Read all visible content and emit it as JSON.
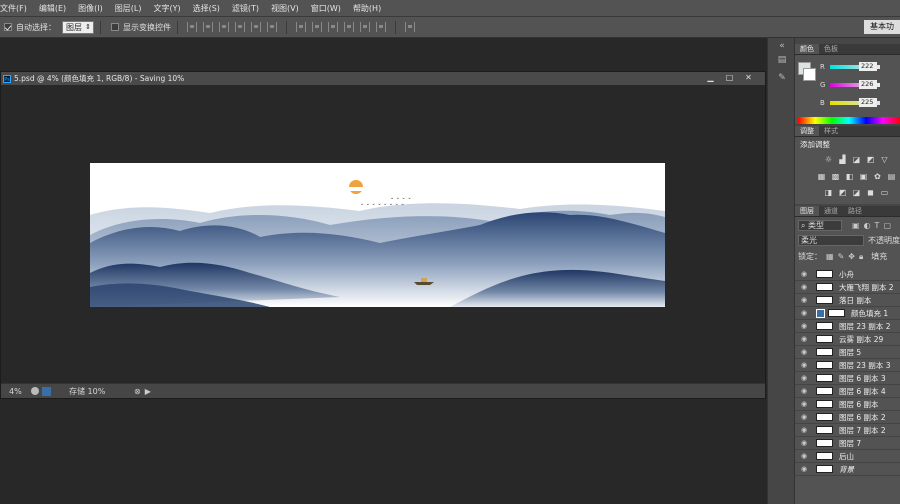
{
  "menu": [
    "文件(F)",
    "编辑(E)",
    "图像(I)",
    "图层(L)",
    "文字(Y)",
    "选择(S)",
    "滤镜(T)",
    "视图(V)",
    "窗口(W)",
    "帮助(H)"
  ],
  "options": {
    "auto_select_label": "自动选择：",
    "auto_select_value": "图层",
    "show_transform_label": "显示变换控件",
    "workspace": "基本功"
  },
  "document": {
    "title": "5.psd @ 4% (颜色填充 1, RGB/8) - Saving 10%",
    "zoom": "4%",
    "status": "存储 10%"
  },
  "color_panel": {
    "tabs": [
      "颜色",
      "色板"
    ],
    "r_label": "R",
    "g_label": "G",
    "b_label": "B",
    "r": "222",
    "g": "226",
    "b": "225"
  },
  "adjust_panel": {
    "tabs": [
      "调整",
      "样式"
    ],
    "add_label": "添加调整"
  },
  "layers_panel": {
    "tabs": [
      "图层",
      "通道",
      "路径"
    ],
    "filter": "类型",
    "blend": "柔光",
    "opacity_label": "不透明度",
    "lock_label": "锁定：",
    "fill_label": "填充",
    "layers": [
      "小舟",
      "大雁飞翔 副本 2",
      "落日 副本",
      "颜色填充 1",
      "图层 23 副本 2",
      "云雾 副本 29",
      "图层 5",
      "图层 23 副本 3",
      "图层 6 副本 3",
      "图层 6 副本 4",
      "图层 6 副本",
      "图层 6 副本 2",
      "图层 7 副本 2",
      "图层 7",
      "后山",
      "背景"
    ]
  },
  "colors": {
    "accent_blue": "#2d4a7a",
    "sun": "#f0a33c"
  }
}
